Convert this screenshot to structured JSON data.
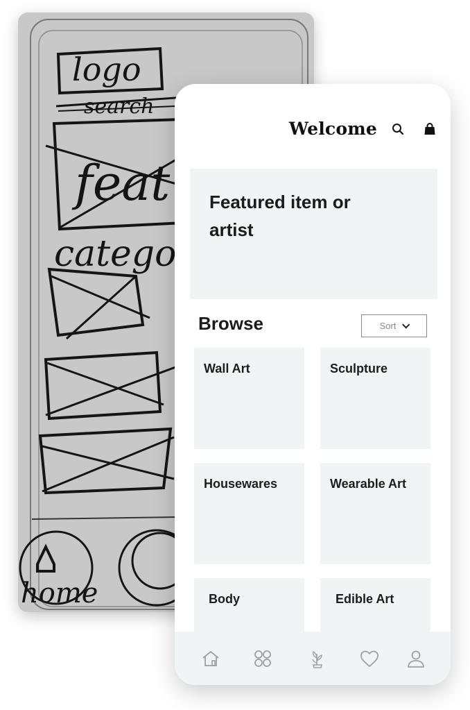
{
  "sketch": {
    "words": {
      "logo": "logo",
      "search": "search",
      "featured": "feat",
      "categories": "categor",
      "home": "home"
    }
  },
  "phone": {
    "header": {
      "title": "Welcome",
      "icons": [
        "search-icon",
        "shopping-bag-icon"
      ]
    },
    "featured": {
      "text": "Featured item or artist"
    },
    "browse": {
      "title": "Browse",
      "sort_label": "Sort"
    },
    "categories": [
      "Wall Art",
      "Sculpture",
      "Housewares",
      "Wearable Art",
      "Body",
      "Edible Art"
    ],
    "tabbar": {
      "icons": [
        "home-icon",
        "grid-icon",
        "plant-icon",
        "heart-icon",
        "user-icon"
      ]
    },
    "colors": {
      "tile_bg": "#f1f4f5",
      "text": "#1b1b1b",
      "sketch_bg": "#c8c8c8"
    }
  }
}
